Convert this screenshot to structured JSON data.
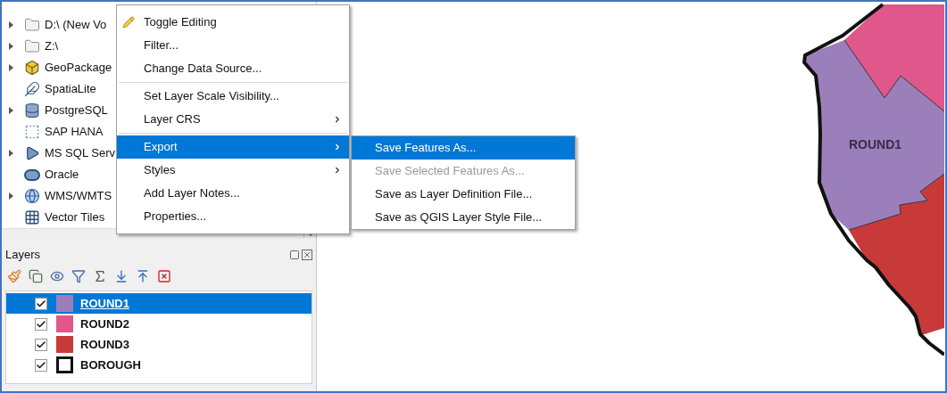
{
  "browser": {
    "items": [
      {
        "label": "D:\\ (New Vo",
        "kind": "folder",
        "expandable": true
      },
      {
        "label": "Z:\\",
        "kind": "folder",
        "expandable": true
      },
      {
        "label": "GeoPackage",
        "kind": "geopackage",
        "expandable": true
      },
      {
        "label": "SpatiaLite",
        "kind": "spatialite",
        "expandable": false
      },
      {
        "label": "PostgreSQL",
        "kind": "postgres",
        "expandable": true
      },
      {
        "label": "SAP HANA",
        "kind": "saphana",
        "expandable": false
      },
      {
        "label": "MS SQL Serv",
        "kind": "mssql",
        "expandable": true
      },
      {
        "label": "Oracle",
        "kind": "oracle",
        "expandable": false
      },
      {
        "label": "WMS/WMTS",
        "kind": "wms",
        "expandable": true
      },
      {
        "label": "Vector Tiles",
        "kind": "vectortiles",
        "expandable": false
      }
    ]
  },
  "layers": {
    "title": "Layers",
    "items": [
      {
        "name": "ROUND1",
        "checked": true,
        "selected": true,
        "kind": "fill",
        "color": "#9b7fba"
      },
      {
        "name": "ROUND2",
        "checked": true,
        "selected": false,
        "kind": "fill",
        "color": "#e0578c"
      },
      {
        "name": "ROUND3",
        "checked": true,
        "selected": false,
        "kind": "fill",
        "color": "#c83a3a"
      },
      {
        "name": "BOROUGH",
        "checked": true,
        "selected": false,
        "kind": "outline",
        "color": "#111111"
      }
    ]
  },
  "context_menu": {
    "items": [
      {
        "label": "Toggle Editing",
        "kind": "item",
        "icon": true,
        "submenu": false,
        "selected": false
      },
      {
        "label": "Filter...",
        "kind": "item",
        "icon": false,
        "submenu": false,
        "selected": false
      },
      {
        "label": "Change Data Source...",
        "kind": "item",
        "icon": false,
        "submenu": false,
        "selected": false
      },
      {
        "kind": "separator"
      },
      {
        "label": "Set Layer Scale Visibility...",
        "kind": "item",
        "icon": false,
        "submenu": false,
        "selected": false
      },
      {
        "label": "Layer CRS",
        "kind": "item",
        "icon": false,
        "submenu": true,
        "selected": false
      },
      {
        "kind": "separator"
      },
      {
        "label": "Export",
        "kind": "item",
        "icon": false,
        "submenu": true,
        "selected": true
      },
      {
        "label": "Styles",
        "kind": "item",
        "icon": false,
        "submenu": true,
        "selected": false
      },
      {
        "label": "Add Layer Notes...",
        "kind": "item",
        "icon": false,
        "submenu": false,
        "selected": false
      },
      {
        "label": "Properties...",
        "kind": "item",
        "icon": false,
        "submenu": false,
        "selected": false
      }
    ]
  },
  "export_submenu": {
    "items": [
      {
        "label": "Save Features As...",
        "selected": true,
        "disabled": false
      },
      {
        "label": "Save Selected Features As...",
        "selected": false,
        "disabled": true
      },
      {
        "label": "Save as Layer Definition File...",
        "selected": false,
        "disabled": false
      },
      {
        "label": "Save as QGIS Layer Style File...",
        "selected": false,
        "disabled": false
      }
    ]
  },
  "map": {
    "label": "ROUND1"
  }
}
